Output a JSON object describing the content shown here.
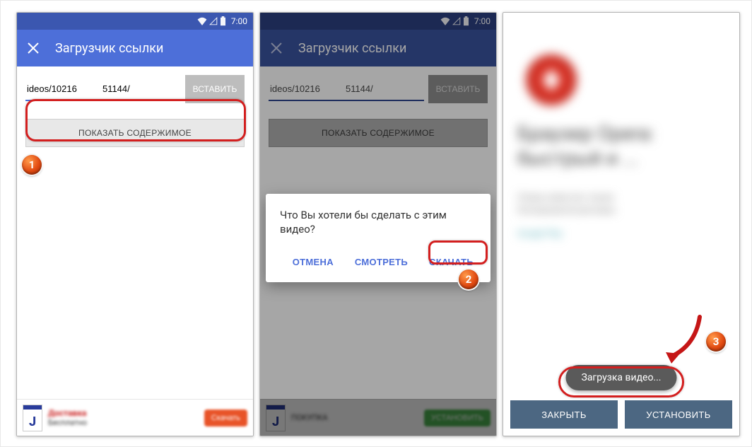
{
  "status": {
    "time": "7:00"
  },
  "appbar_title": "Загрузчик ссылки",
  "url": {
    "value": "ideos/10216          51144/"
  },
  "buttons": {
    "paste": "ВСТАВИТЬ",
    "show": "ПОКАЗАТЬ СОДЕРЖИМОЕ"
  },
  "dialog": {
    "text": "Что Вы хотели бы сделать с этим видео?",
    "cancel": "ОТМЕНА",
    "watch": "СМОТРЕТЬ",
    "download": "СКАЧАТЬ"
  },
  "ad1": {
    "line1": "Доставка",
    "line2": "Бесплатно",
    "cta": "Скачать"
  },
  "ad2": {
    "line1": "ПОКУПКА",
    "cta": "УСТАНОВИТЬ"
  },
  "phone3": {
    "title": "Браузер Opera: быстрый и ...",
    "subtitle1": "Опера известен также",
    "subtitle2": "блокировкой рекламы",
    "gp": "Google Play",
    "close": "ЗАКРЫТЬ",
    "install": "УСТАНОВИТЬ",
    "toast": "Загрузка видео..."
  },
  "markers": {
    "m1": "1",
    "m2": "2",
    "m3": "3"
  }
}
